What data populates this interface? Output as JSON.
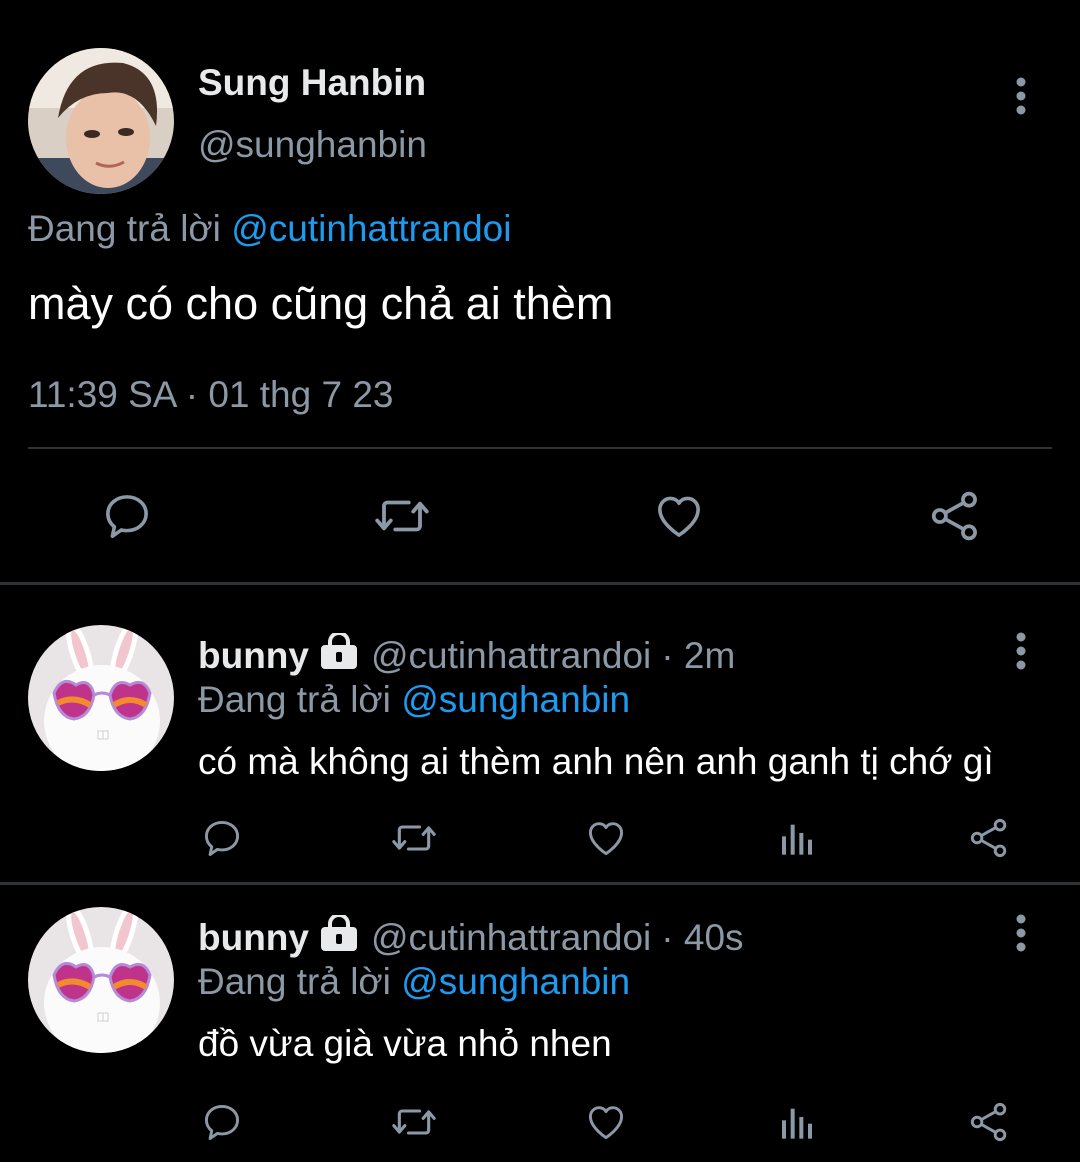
{
  "main_tweet": {
    "name": "Sung Hanbin",
    "handle": "@sunghanbin",
    "replying_label": "Đang trả lời",
    "replying_to": "@cutinhattrandoi",
    "text": "mày có cho cũng chả ai thèm",
    "timestamp": "11:39 SA · 01 thg 7 23",
    "actions": [
      "reply-icon",
      "retweet-icon",
      "like-icon",
      "share-icon"
    ]
  },
  "replies": [
    {
      "name": "bunny",
      "handle": "@cutinhattrandoi",
      "age": "· 2m",
      "replying_label": "Đang trả lời",
      "replying_to": "@sunghanbin",
      "text": "có mà không ai thèm anh nên anh ganh tị chớ gì",
      "actions": [
        "reply-icon",
        "retweet-icon",
        "like-icon",
        "analytics-icon",
        "share-icon"
      ]
    },
    {
      "name": "bunny",
      "handle": "@cutinhattrandoi",
      "age": "· 40s",
      "replying_label": "Đang trả lời",
      "replying_to": "@sunghanbin",
      "text": "đồ vừa già vừa nhỏ nhen",
      "actions": [
        "reply-icon",
        "retweet-icon",
        "like-icon",
        "analytics-icon",
        "share-icon"
      ]
    }
  ],
  "colors": {
    "background": "#000000",
    "text": "#e7e9ea",
    "secondary": "#8b98a5",
    "mention": "#1d9bf0",
    "divider": "#2f3336"
  }
}
